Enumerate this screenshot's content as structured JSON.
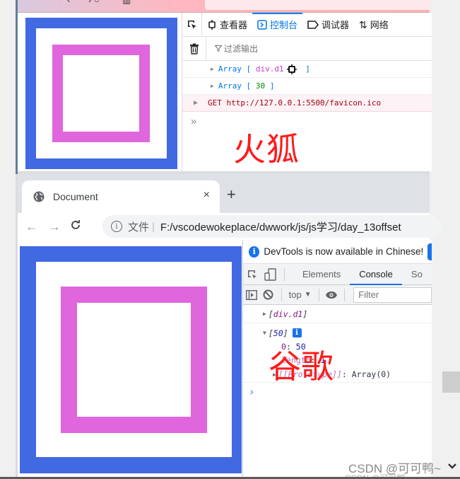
{
  "colors": {
    "outer_box": "#4169E1",
    "inner_box": "#E066DD",
    "overlay_label": "#FF1A1A",
    "firefox_accent": "#0A84FF",
    "chrome_accent": "#1A73E8"
  },
  "firefox": {
    "devtools": {
      "tabs": [
        {
          "icon": "inspector-icon",
          "label": "查看器"
        },
        {
          "icon": "console-icon",
          "label": "控制台",
          "active": true
        },
        {
          "icon": "debugger-icon",
          "label": "调试器"
        },
        {
          "icon": "network-icon",
          "label": "网络"
        }
      ],
      "filter_placeholder": "过滤输出",
      "console": [
        {
          "prefix": "Array",
          "open": "[",
          "node_tag": "div",
          "node_class": ".d1",
          "close": "]"
        },
        {
          "prefix": "Array",
          "open": "[",
          "value": "30",
          "close": "]"
        }
      ],
      "error_row": "GET http://127.0.0.1:5500/favicon.ico",
      "prompt": "»"
    },
    "overlay_label": "火狐"
  },
  "chrome": {
    "tab": {
      "title": "Document",
      "close": "×"
    },
    "new_tab": "+",
    "toolbar": {
      "back": "←",
      "forward": "→",
      "reload": "C",
      "scheme_label": "文件",
      "separator": "|",
      "url": "F:/vscodewokeplace/dwwork/js/js学习/day_13offset"
    },
    "devtools": {
      "info_banner": "DevTools is now available in Chinese!",
      "tabs": [
        "Elements",
        "Console",
        "So"
      ],
      "active_tab": "Console",
      "context": "top",
      "filter_placeholder": "Filter",
      "console": {
        "row1": {
          "open": "[",
          "node": "div.d1",
          "close": "]"
        },
        "row2": {
          "open": "[",
          "value": "50",
          "close": "]",
          "badge": "i"
        },
        "entry_index": {
          "key": "0",
          "value": "50"
        },
        "entry_length": {
          "key": "length",
          "value": "1"
        },
        "entry_proto": {
          "key": "[[Prototype]]",
          "value": "Array(0)"
        }
      },
      "prompt": "›"
    },
    "overlay_label": "谷歌"
  },
  "watermark": "CSDN @可可鸭~",
  "watermark_ghost": "CSDN @可可鸭"
}
